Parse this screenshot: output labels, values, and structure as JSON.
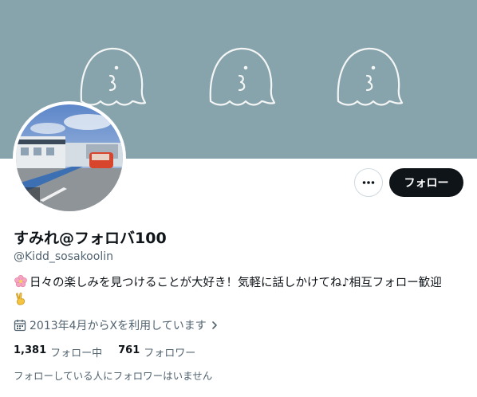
{
  "profile": {
    "display_name": "すみれ@フォロバ100",
    "handle": "@Kidd_sosakoolin",
    "bio_text": "日々の楽しみを見つけることが大好き！気軽に話しかけてね♪相互フォロー歓迎",
    "joined": "2013年4月からXを利用しています",
    "following_count": "1,381",
    "following_label": "フォロー中",
    "followers_count": "761",
    "followers_label": "フォロワー",
    "mutual_note": "フォローしている人にフォロワーはいません"
  },
  "actions": {
    "follow_label": "フォロー"
  },
  "icons": {
    "more": "more-icon",
    "calendar": "calendar-icon",
    "chevron": "chevron-right-icon",
    "flower": "cherry-blossom-emoji",
    "peace": "victory-hand-emoji"
  },
  "colors": {
    "banner": "#87a3ab",
    "text_primary": "#0f1419",
    "text_secondary": "#536471",
    "follow_button": "#0f1419"
  }
}
